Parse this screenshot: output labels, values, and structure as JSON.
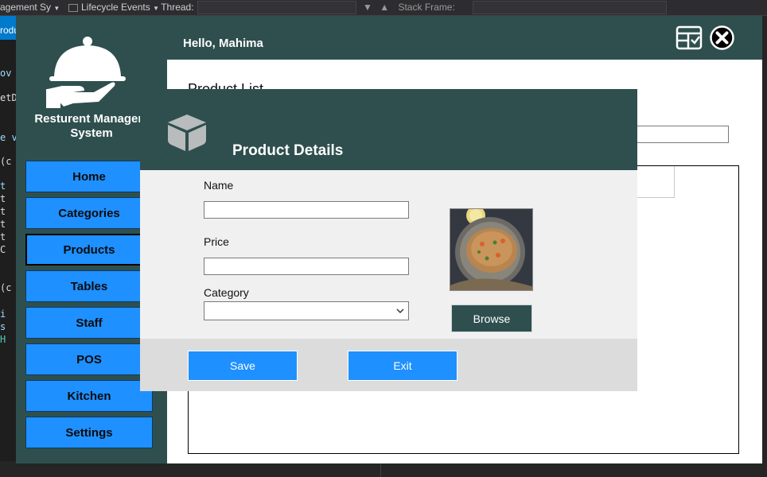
{
  "ide": {
    "toolbar": {
      "project": "agement Sy",
      "lifecycle": "Lifecycle Events",
      "thread": "Thread:",
      "stack_frame": "Stack Frame:"
    },
    "tab_label": "rodu",
    "code_lines": [
      "ov",
      "etDa",
      "e v",
      "(c",
      "t",
      "t",
      "t",
      "t",
      "t",
      "C",
      "(c",
      "i",
      "s",
      "H"
    ]
  },
  "app": {
    "title": "Resturent Managem\nSystem",
    "greeting": "Hello, Mahima",
    "nav": [
      {
        "label": "Home"
      },
      {
        "label": "Categories"
      },
      {
        "label": "Products",
        "active": true
      },
      {
        "label": "Tables"
      },
      {
        "label": "Staff"
      },
      {
        "label": "POS"
      },
      {
        "label": "Kitchen"
      },
      {
        "label": "Settings"
      }
    ],
    "content_title": "Product List",
    "icons": [
      "serving-cloche-icon",
      "switch-window-icon",
      "close-circle-icon"
    ],
    "colors": {
      "panel": "#2f4f4f",
      "button": "#1e90ff",
      "ide_accent": "#007acc"
    }
  },
  "dialog": {
    "title": "Product Details",
    "icon": "box-icon",
    "fields": {
      "name_label": "Name",
      "name_value": "",
      "price_label": "Price",
      "price_value": "",
      "category_label": "Category",
      "category_value": ""
    },
    "browse_label": "Browse",
    "save_label": "Save",
    "exit_label": "Exit"
  }
}
